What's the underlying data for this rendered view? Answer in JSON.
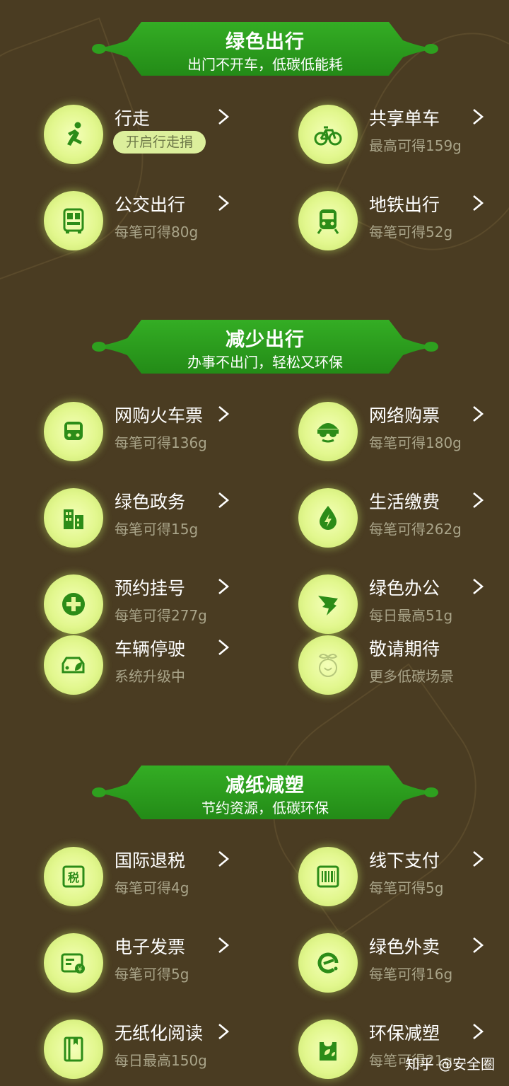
{
  "colors": {
    "background": "#4a3c22",
    "banner_green": "#2ea01f",
    "icon_green": "#2c8c18",
    "circle": "#e6f79a",
    "subtext": "#a9a489"
  },
  "sections": [
    {
      "title": "绿色出行",
      "subtitle": "出门不开车，低碳低能耗",
      "items": [
        {
          "label": "行走",
          "sub": "开启行走捐",
          "icon": "running-person-icon",
          "pill": true
        },
        {
          "label": "共享单车",
          "sub": "最高可得159g",
          "icon": "bicycle-icon"
        },
        {
          "label": "公交出行",
          "sub": "每笔可得80g",
          "icon": "bus-icon"
        },
        {
          "label": "地铁出行",
          "sub": "每笔可得52g",
          "icon": "subway-icon"
        }
      ]
    },
    {
      "title": "减少出行",
      "subtitle": "办事不出门，轻松又环保",
      "items": [
        {
          "label": "网购火车票",
          "sub": "每笔可得136g",
          "icon": "train-icon"
        },
        {
          "label": "网络购票",
          "sub": "每笔可得180g",
          "icon": "movie-glasses-icon"
        },
        {
          "label": "绿色政务",
          "sub": "每笔可得15g",
          "icon": "government-building-icon"
        },
        {
          "label": "生活缴费",
          "sub": "每笔可得262g",
          "icon": "water-drop-bolt-icon"
        },
        {
          "label": "预约挂号",
          "sub": "每笔可得277g",
          "icon": "medical-cross-icon"
        },
        {
          "label": "绿色办公",
          "sub": "每日最高51g",
          "icon": "dingtalk-wing-icon"
        },
        {
          "label": "车辆停驶",
          "sub": "系统升级中",
          "icon": "car-leaf-icon",
          "disabled": true
        },
        {
          "label": "敬请期待",
          "sub": "更多低碳场景",
          "icon": "seedling-icon",
          "disabled": true,
          "no_chevron": true
        }
      ]
    },
    {
      "title": "减纸减塑",
      "subtitle": "节约资源，低碳环保",
      "items": [
        {
          "label": "国际退税",
          "sub": "每笔可得4g",
          "icon": "tax-refund-icon",
          "icon_text": "税"
        },
        {
          "label": "线下支付",
          "sub": "每笔可得5g",
          "icon": "barcode-icon"
        },
        {
          "label": "电子发票",
          "sub": "每笔可得5g",
          "icon": "e-invoice-icon"
        },
        {
          "label": "绿色外卖",
          "sub": "每笔可得16g",
          "icon": "eleme-icon"
        },
        {
          "label": "无纸化阅读",
          "sub": "每日最高150g",
          "icon": "book-icon"
        },
        {
          "label": "环保减塑",
          "sub": "每笔可得21g",
          "icon": "eco-bag-icon"
        }
      ]
    }
  ],
  "watermark": {
    "text": "知乎 @安全圈"
  }
}
